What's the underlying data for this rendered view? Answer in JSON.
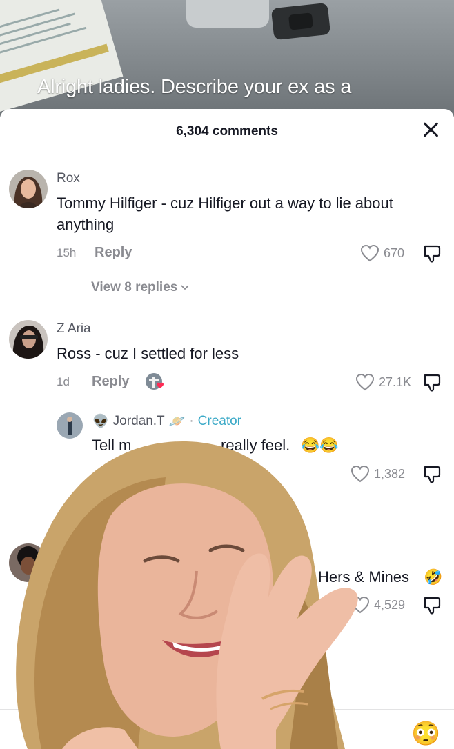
{
  "video": {
    "overlay_text": "Alright ladies. Describe your ex as a"
  },
  "sheet": {
    "title": "6,304 comments"
  },
  "comments": [
    {
      "username": "Rox",
      "text": "Tommy Hilfiger - cuz Hilfiger out a way to lie about anything",
      "time": "15h",
      "reply_label": "Reply",
      "likes": "670",
      "view_replies": "View 8 replies"
    },
    {
      "username": "Z Aria",
      "text": "Ross - cuz I settled for less",
      "time": "1d",
      "reply_label": "Reply",
      "likes": "27.1K"
    },
    {
      "username": "Jordan.T",
      "badge": "Creator",
      "text_visible_start": "Tell m",
      "text_visible_end": "really feel.",
      "emoji": "😂😂",
      "likes": "1,382",
      "is_reply": true
    },
    {
      "text_visible": "Hers & Mines",
      "emoji": "🤣",
      "likes": "4,529"
    }
  ],
  "bottom": {
    "emoji": "😳"
  },
  "colors": {
    "creator": "#3aa9c7",
    "muted": "#8a8b91",
    "text": "#161823"
  }
}
